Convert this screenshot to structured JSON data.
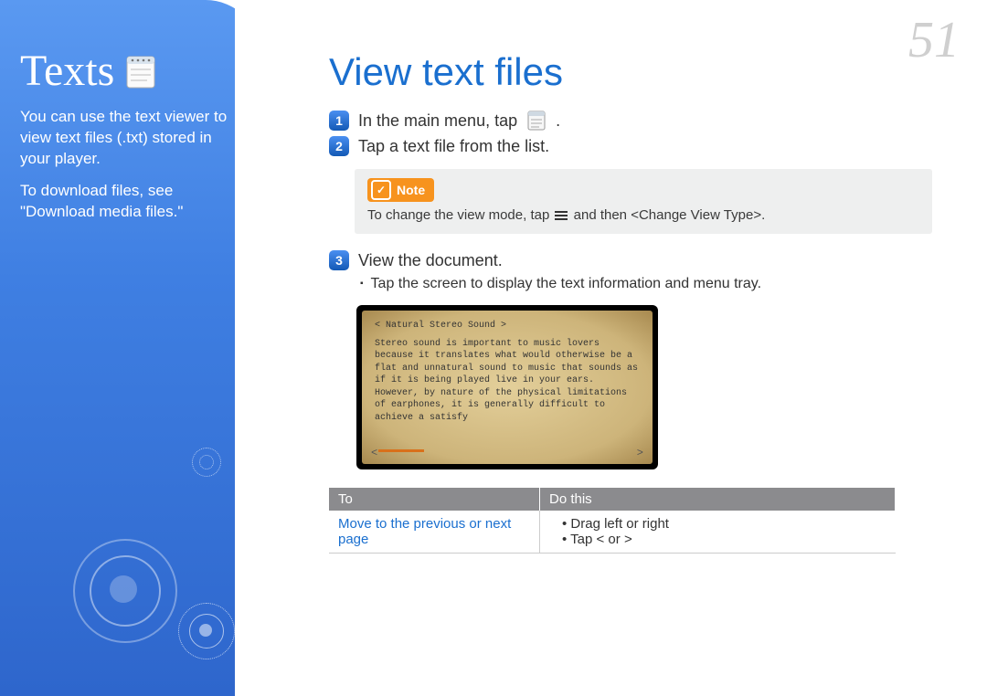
{
  "page_number": "51",
  "sidebar": {
    "title": "Texts",
    "intro": "You can use the text viewer to view text files (.txt) stored in your player.",
    "download_line": "To download files, see \"Download media files.\""
  },
  "main": {
    "title": "View text files",
    "step1_prefix": "In the main menu, tap",
    "step1_suffix": ".",
    "step2": "Tap a text file from the list.",
    "note_label": "Note",
    "note_text_prefix": "To change the view mode, tap",
    "note_text_suffix": "and then <Change View Type>.",
    "step3": "View the document.",
    "step3_bullet": "Tap the screen to display the text information and menu tray.",
    "preview": {
      "header": "< Natural Stereo Sound >",
      "body": "Stereo sound is important to music lovers because it translates what would otherwise be a flat and unnatural sound to music that sounds as if it is being played live in your ears. However, by nature of the physical limitations of earphones, it is generally difficult to achieve a satisfy",
      "prev": "<",
      "next": ">"
    },
    "table": {
      "col1": "To",
      "col2": "Do this",
      "row1_to": "Move to the previous or next page",
      "row1_do1": "Drag left or right",
      "row1_do2": "Tap < or >"
    }
  }
}
